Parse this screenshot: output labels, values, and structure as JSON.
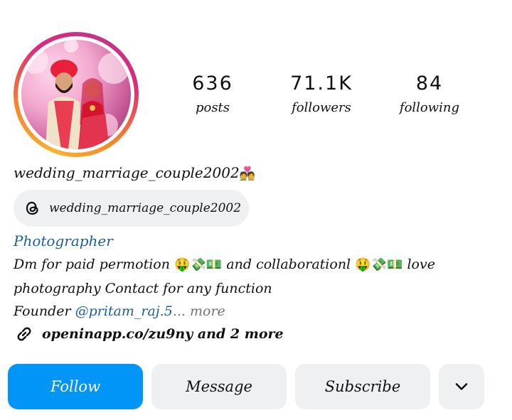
{
  "stats": [
    {
      "value": "636",
      "label": "posts"
    },
    {
      "value": "71.1K",
      "label": "followers"
    },
    {
      "value": "84",
      "label": "following"
    }
  ],
  "profile": {
    "username": "wedding_marriage_couple2002",
    "username_emoji": "💑",
    "threads_handle": "wedding_marriage_couple2002",
    "category": "Photographer"
  },
  "bio": {
    "line1_a": "Dm for paid permotion",
    "line1_emoji1": "🤑💸💵",
    "line1_b": "and collaborationl",
    "line1_emoji2": "🤑💸💵",
    "line1_c": "love",
    "line2": "photography Contact for any function",
    "line3_prefix": "Founder",
    "mention": "@pritam_raj.5",
    "more": "... more"
  },
  "link": {
    "text": "openinapp.co/zu9ny and 2 more"
  },
  "buttons": {
    "follow": "Follow",
    "message": "Message",
    "subscribe": "Subscribe"
  },
  "colors": {
    "accent": "#0095f6",
    "link_blue": "#1e5e9b",
    "button_bg": "#eef0f2"
  }
}
